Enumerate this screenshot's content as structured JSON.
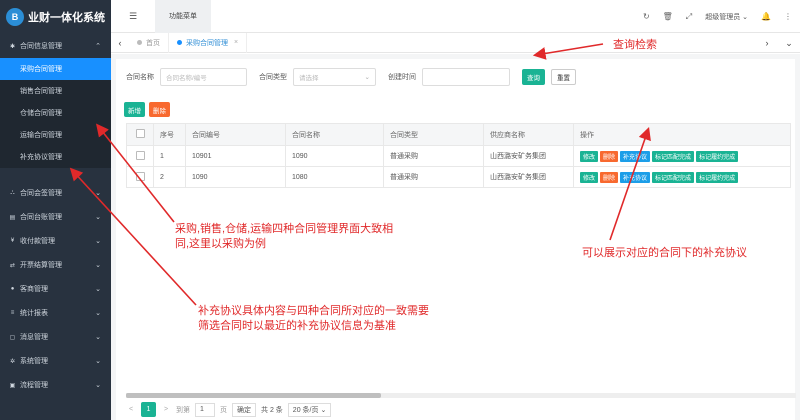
{
  "logo": {
    "mark": "B",
    "text": "业财一体化系统"
  },
  "sidebar": {
    "groups": [
      {
        "label": "合同信息管理",
        "expanded": true,
        "items": [
          {
            "label": "采购合同管理",
            "active": true
          },
          {
            "label": "销售合同管理"
          },
          {
            "label": "仓储合同管理"
          },
          {
            "label": "运输合同管理"
          },
          {
            "label": "补充协议管理"
          }
        ]
      },
      {
        "label": "合同会签管理"
      },
      {
        "label": "合同台账管理"
      },
      {
        "label": "收付款管理"
      },
      {
        "label": "开票结算管理"
      },
      {
        "label": "客商管理"
      },
      {
        "label": "统计报表"
      },
      {
        "label": "消息管理"
      },
      {
        "label": "系统管理"
      },
      {
        "label": "流程管理"
      }
    ]
  },
  "topbar": {
    "menu_icon": "☰",
    "func_tab": "功能菜单",
    "admin": "超级管理员"
  },
  "tabs": [
    {
      "label": "首页",
      "active": false
    },
    {
      "label": "采购合同管理",
      "active": true,
      "close": "×"
    }
  ],
  "search": {
    "contract_name_label": "合同名称",
    "contract_name_placeholder": "合同名称/编号",
    "contract_type_label": "合同类型",
    "contract_type_placeholder": "请选择",
    "create_time_label": "创建时间",
    "search_btn": "查询",
    "reset_btn": "重置"
  },
  "toolbar": {
    "add": "新增",
    "delete": "删除"
  },
  "table": {
    "columns": [
      "序号",
      "合同编号",
      "合同名称",
      "合同类型",
      "供应商名称",
      "操作"
    ],
    "rows": [
      {
        "no": "1",
        "code": "10901",
        "name": "1090",
        "type": "普通采购",
        "supplier": "山西潞安矿务集团"
      },
      {
        "no": "2",
        "code": "1090",
        "name": "1080",
        "type": "普通采购",
        "supplier": "山西潞安矿务集团"
      }
    ],
    "actions": [
      "修改",
      "删除",
      "补充协议",
      "标记匹配完成",
      "标记履约完成"
    ]
  },
  "pager": {
    "prev": "<",
    "page": "1",
    "next": ">",
    "goto_label": "到第",
    "goto_value": "1",
    "page_unit": "页",
    "confirm": "确定",
    "total": "共 2 条",
    "size": "20 条/页"
  },
  "annotations": {
    "search": "查询检索",
    "four_types": "采购,销售,仓储,运输四种合同管理界面大致相同,这里以采购为例",
    "supplement": "补充协议具体内容与四种合同所对应的一致需要筛选合同时以最近的补充协议信息为基准",
    "show_supplement": "可以展示对应的合同下的补充协议"
  },
  "colors": {
    "sidebar": "#28323f",
    "active": "#1890ff",
    "green": "#1ab394",
    "orange": "#f8692f",
    "annotation": "#e0292a"
  }
}
